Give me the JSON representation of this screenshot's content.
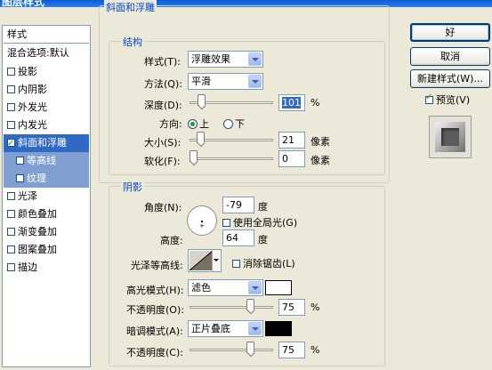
{
  "window": {
    "title": "图层样式"
  },
  "style_list": {
    "header": "样式",
    "blend_options": "混合选项:默认",
    "items": [
      {
        "label": "投影",
        "checked": false
      },
      {
        "label": "内阴影",
        "checked": false
      },
      {
        "label": "外发光",
        "checked": false
      },
      {
        "label": "内发光",
        "checked": false
      },
      {
        "label": "斜面和浮雕",
        "checked": true,
        "selected": true
      },
      {
        "label": "等高线",
        "checked": false,
        "sub": true
      },
      {
        "label": "纹理",
        "checked": false,
        "sub": true
      },
      {
        "label": "光泽",
        "checked": false
      },
      {
        "label": "颜色叠加",
        "checked": false
      },
      {
        "label": "渐变叠加",
        "checked": false
      },
      {
        "label": "图案叠加",
        "checked": false
      },
      {
        "label": "描边",
        "checked": false
      }
    ]
  },
  "bevel": {
    "section_title": "斜面和浮雕",
    "structure": {
      "title": "结构",
      "style_label": "样式(T):",
      "style_value": "浮雕效果",
      "technique_label": "方法(Q):",
      "technique_value": "平滑",
      "depth_label": "深度(D):",
      "depth_value": "101",
      "depth_unit": "%",
      "depth_level": 0.1,
      "direction_label": "方向:",
      "dir_up": "上",
      "dir_down": "下",
      "direction": "上",
      "size_label": "大小(S):",
      "size_value": "21",
      "size_unit": "像素",
      "size_level": 0.09,
      "soften_label": "软化(F):",
      "soften_value": "0",
      "soften_unit": "像素",
      "soften_level": 0
    },
    "shading": {
      "title": "阴影",
      "angle_label": "角度(N):",
      "angle_value": "-79",
      "angle_unit": "度",
      "global_light_label": "使用全局光(G)",
      "global_light": false,
      "altitude_label": "高度:",
      "altitude_value": "64",
      "altitude_unit": "度",
      "gloss_label": "光泽等高线:",
      "antialias_label": "消除锯齿(L)",
      "antialias": false,
      "highlight_mode_label": "高光模式(H):",
      "highlight_mode": "滤色",
      "highlight_color": "#ffffff",
      "highlight_opacity_label": "不透明度(O):",
      "highlight_opacity": "75",
      "highlight_opacity_unit": "%",
      "highlight_opacity_level": 0.75,
      "shadow_mode_label": "暗调模式(A):",
      "shadow_mode": "正片叠底",
      "shadow_color": "#000000",
      "shadow_opacity_label": "不透明度(C):",
      "shadow_opacity": "75",
      "shadow_opacity_unit": "%",
      "shadow_opacity_level": 0.75
    }
  },
  "buttons": {
    "ok": "好",
    "cancel": "取消",
    "new_style": "新建样式(W)...",
    "preview_label": "预览(V)",
    "preview_checked": true
  }
}
